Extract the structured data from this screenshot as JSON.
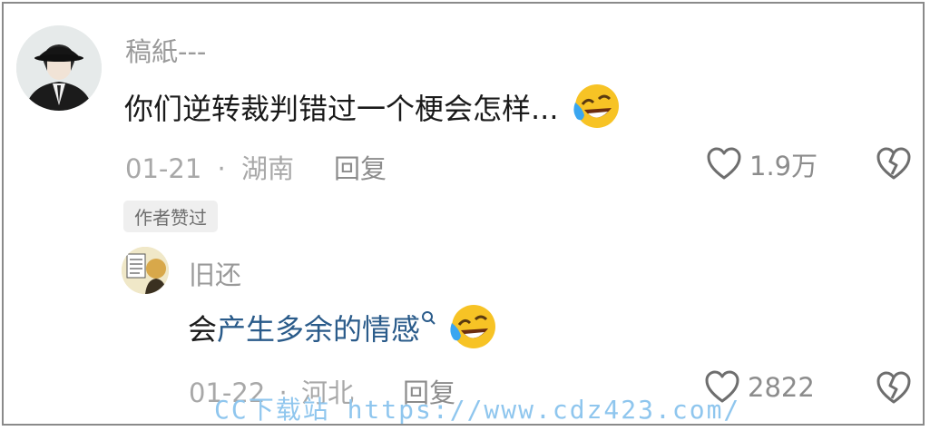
{
  "comment": {
    "username": "稿紙---",
    "text": "你们逆转裁判错过一个梗会怎样...",
    "date": "01-21",
    "separator": "·",
    "location": "湖南",
    "reply_label": "回复",
    "like_count": "1.9万",
    "author_badge": "作者赞过"
  },
  "reply": {
    "username": "旧还",
    "text_prefix": "会",
    "text_link": "产生多余的情感",
    "date": "01-22",
    "separator": "·",
    "location": "河北",
    "reply_label": "回复",
    "like_count": "2822"
  },
  "watermark": "CC下载站 https://www.cdz423.com/",
  "icons": {
    "like": "heart-outline-icon",
    "dislike": "broken-heart-icon",
    "emoji": "laughing-crying-emoji-icon",
    "search": "search-icon"
  },
  "colors": {
    "username": "#9a9a9a",
    "text": "#1a1a1a",
    "link": "#2a5b8a",
    "meta": "#a8a8a8",
    "badge_bg": "#efefef",
    "watermark": "#8fc6ee"
  }
}
